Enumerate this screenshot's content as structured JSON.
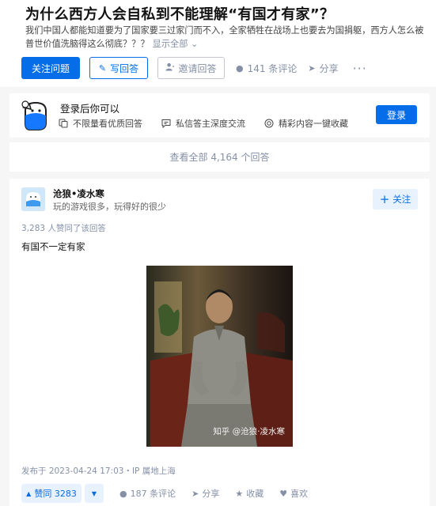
{
  "question": {
    "title": "为什么西方人会自私到不能理解“有国才有家”？",
    "description": "我们中国人都能知道要为了国家要三过家门而不入，全家牺牲在战场上也要去为国捐躯，西方人怎么被普世价值洗脑得这么彻底？？？",
    "show_all": "显示全部",
    "actions": {
      "follow": "关注问题",
      "write": "写回答",
      "invite": "邀请回答",
      "comments": "141 条评论",
      "share": "分享",
      "more": "···"
    }
  },
  "login_prompt": {
    "title": "登录后你可以",
    "features": [
      "不限量看优质回答",
      "私信答主深度交流",
      "精彩内容一键收藏"
    ],
    "button": "登录"
  },
  "view_all": "查看全部 4,164 个回答",
  "answer": {
    "author_name": "沧狼•凌水寒",
    "author_bio": "玩的游戏很多，玩得好的很少",
    "follow": "关注",
    "voters": "3,283 人赞同了该回答",
    "content": "有国不一定有家",
    "image_watermark": "知乎 @沧狼·凌水寒",
    "published": "发布于 2023-04-24 17:03・IP 属地上海",
    "actions": {
      "upvote": "赞同 3283",
      "comments": "187 条评论",
      "share": "分享",
      "favorite": "收藏",
      "like": "喜欢"
    }
  },
  "colors": {
    "brand": "#056de8",
    "muted": "#8590a6",
    "page_bg": "#f6f6f6"
  }
}
